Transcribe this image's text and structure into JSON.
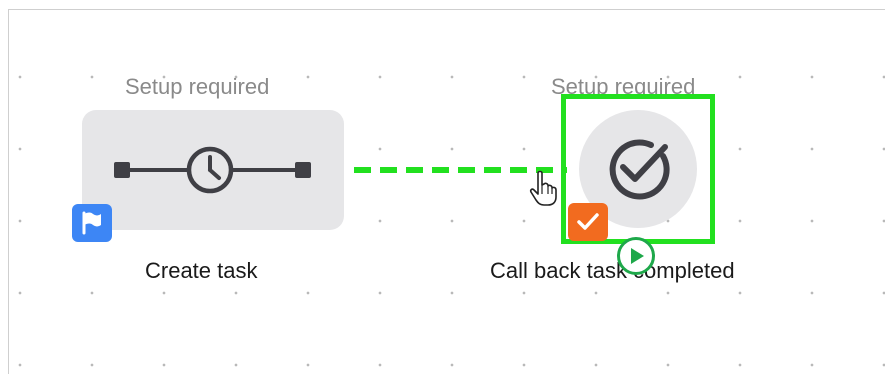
{
  "workflow": {
    "trigger_node": {
      "status": "Setup required",
      "title": "Create task",
      "icon": "clock-timeline-icon",
      "badge_icon": "flag-icon",
      "badge_color": "#3d86f5"
    },
    "action_node": {
      "status": "Setup required",
      "title": "Call back task completed",
      "icon": "check-circle-icon",
      "badge_icon": "checkmark-icon",
      "badge_color": "#f26b1f",
      "selected": true,
      "selection_color": "#22e01f"
    },
    "connector": {
      "style": "dashed",
      "color": "#22e01f"
    },
    "run_handle": {
      "icon": "play-icon",
      "color": "#1ea84a"
    }
  }
}
